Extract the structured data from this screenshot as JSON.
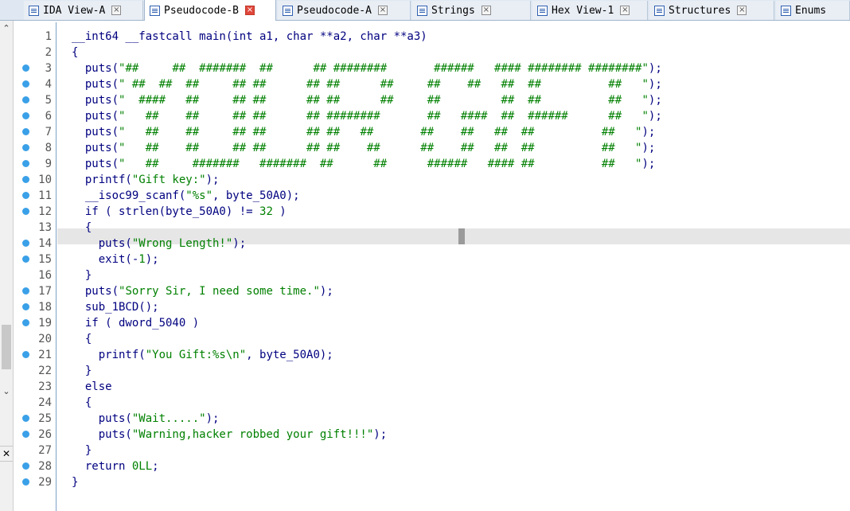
{
  "tabs": [
    {
      "label": "IDA View-A",
      "icon": "disassembly-icon",
      "active": false
    },
    {
      "label": "Pseudocode-B",
      "icon": "pseudocode-icon",
      "active": true
    },
    {
      "label": "Pseudocode-A",
      "icon": "pseudocode-icon",
      "active": false
    },
    {
      "label": "Strings",
      "icon": "strings-icon",
      "active": false
    },
    {
      "label": "Hex View-1",
      "icon": "hex-icon",
      "active": false
    },
    {
      "label": "Structures",
      "icon": "structures-icon",
      "active": false
    },
    {
      "label": "Enums",
      "icon": "enums-icon",
      "active": false
    }
  ],
  "lines": [
    {
      "num": "1",
      "dot": false,
      "text": "__int64 __fastcall main(int a1, char **a2, char **a3)"
    },
    {
      "num": "2",
      "dot": false,
      "text": "{"
    },
    {
      "num": "3",
      "dot": true,
      "text": "  puts(\"##     ##  #######  ##      ## ########       ######   #### ######## ########\");"
    },
    {
      "num": "4",
      "dot": true,
      "text": "  puts(\" ##  ##  ##     ## ##      ## ##      ##     ##    ##   ##  ##          ##   \");"
    },
    {
      "num": "5",
      "dot": true,
      "text": "  puts(\"  ####   ##     ## ##      ## ##      ##     ##         ##  ##          ##   \");"
    },
    {
      "num": "6",
      "dot": true,
      "text": "  puts(\"   ##    ##     ## ##      ## ########       ##   ####  ##  ######      ##   \");"
    },
    {
      "num": "7",
      "dot": true,
      "text": "  puts(\"   ##    ##     ## ##      ## ##   ##       ##    ##   ##  ##          ##   \");"
    },
    {
      "num": "8",
      "dot": true,
      "text": "  puts(\"   ##    ##     ## ##      ## ##    ##      ##    ##   ##  ##          ##   \");"
    },
    {
      "num": "9",
      "dot": true,
      "text": "  puts(\"   ##     #######   #######  ##      ##      ######   #### ##          ##   \");"
    },
    {
      "num": "10",
      "dot": true,
      "text": "  printf(\"Gift key:\");"
    },
    {
      "num": "11",
      "dot": true,
      "text": "  __isoc99_scanf(\"%s\", byte_50A0);"
    },
    {
      "num": "12",
      "dot": true,
      "text": "  if ( strlen(byte_50A0) != 32 )"
    },
    {
      "num": "13",
      "dot": false,
      "text": "  {"
    },
    {
      "num": "14",
      "dot": true,
      "text": "    puts(\"Wrong Length!\");"
    },
    {
      "num": "15",
      "dot": true,
      "text": "    exit(-1);"
    },
    {
      "num": "16",
      "dot": false,
      "text": "  }"
    },
    {
      "num": "17",
      "dot": true,
      "text": "  puts(\"Sorry Sir, I need some time.\");"
    },
    {
      "num": "18",
      "dot": true,
      "text": "  sub_1BCD();"
    },
    {
      "num": "19",
      "dot": true,
      "text": "  if ( dword_5040 )"
    },
    {
      "num": "20",
      "dot": false,
      "text": "  {"
    },
    {
      "num": "21",
      "dot": true,
      "text": "    printf(\"You Gift:%s\\n\", byte_50A0);"
    },
    {
      "num": "22",
      "dot": false,
      "text": "  }"
    },
    {
      "num": "23",
      "dot": false,
      "text": "  else"
    },
    {
      "num": "24",
      "dot": false,
      "text": "  {"
    },
    {
      "num": "25",
      "dot": true,
      "text": "    puts(\"Wait.....\");"
    },
    {
      "num": "26",
      "dot": true,
      "text": "    puts(\"Warning,hacker robbed your gift!!!\");"
    },
    {
      "num": "27",
      "dot": false,
      "text": "  }"
    },
    {
      "num": "28",
      "dot": true,
      "text": "  return 0LL;"
    },
    {
      "num": "29",
      "dot": true,
      "text": "}"
    }
  ],
  "colors": {
    "keyword": "#000080",
    "string": "#008000",
    "breakpoint_dot": "#3aa0e8",
    "highlight": "#e6e6e6"
  }
}
